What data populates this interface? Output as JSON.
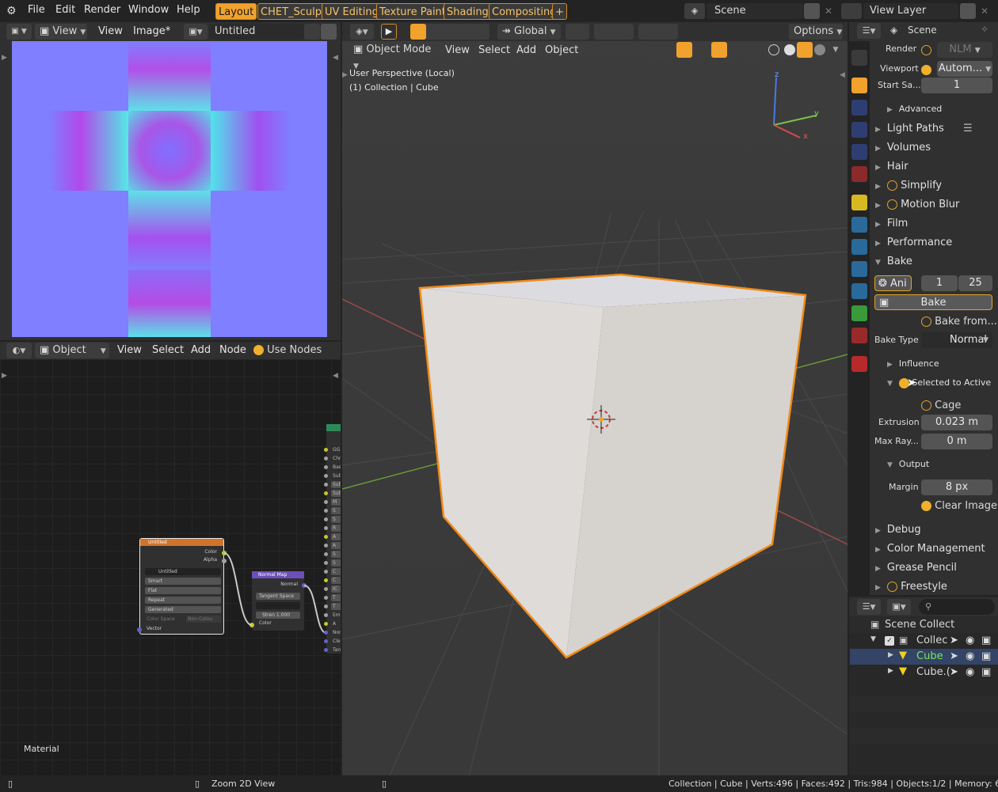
{
  "topbar": {
    "menus": [
      "File",
      "Edit",
      "Render",
      "Window",
      "Help"
    ],
    "workspaces": [
      "Layout",
      "CHET_Sculpt",
      "UV Editing",
      "Texture Paint",
      "Shading",
      "Compositing"
    ],
    "add_tab": "+",
    "scene_name": "Scene",
    "view_layer": "View Layer"
  },
  "image_editor": {
    "view_menu": "View",
    "view2": "View",
    "image_menu": "Image*",
    "image_name": "Untitled"
  },
  "node_editor": {
    "object_select": "Object",
    "menus": [
      "View",
      "Select",
      "Add",
      "Node"
    ],
    "use_nodes": "Use Nodes",
    "footer_label": "Material",
    "image_node": {
      "title": "Untitled",
      "outputs": [
        "Color",
        "Alpha"
      ],
      "image_name": "Untitled",
      "interpolation": "Smart",
      "projection": "Flat",
      "extension": "Repeat",
      "source": "Generated",
      "color_space_label": "Color Space",
      "color_space_value": "Non-Colou",
      "input": "Vector"
    },
    "normal_map_node": {
      "title": "Normal Map",
      "output": "Normal",
      "space": "Tangent Space",
      "strength_label": "Stren",
      "strength_value": "1.000",
      "input": "Color"
    },
    "bsdf_labels": [
      "GG",
      "Chr",
      "Base",
      "Sub",
      "Sub",
      "Subs",
      "M",
      "S",
      "S",
      "R",
      "A",
      "A",
      "S",
      "S",
      "C",
      "C",
      "IC",
      "T",
      "T",
      "Emi",
      "A",
      "Nor",
      "Clea",
      "Tang"
    ]
  },
  "viewport": {
    "transform": "Global",
    "options": "Options",
    "mode": "Object Mode",
    "menus": [
      "View",
      "Select",
      "Add",
      "Object"
    ],
    "info_line1": "User Perspective (Local)",
    "info_line2": "(1) Collection | Cube",
    "axis_x": "x",
    "axis_y": "y",
    "axis_z": "z"
  },
  "properties": {
    "context": "Scene",
    "render_label": "Render",
    "render_value": "NLM",
    "viewport_label": "Viewport",
    "viewport_value": "Autom...",
    "start_samples_label": "Start Sa...",
    "start_samples_value": "1",
    "advanced": "Advanced",
    "sections": [
      "Light Paths",
      "Volumes",
      "Hair",
      "Simplify",
      "Motion Blur",
      "Film",
      "Performance",
      "Bake"
    ],
    "bake": {
      "animation": "Ani",
      "frame_start": "1",
      "frame_end": "25",
      "bake_button": "Bake",
      "bake_from": "Bake from...",
      "bake_type_label": "Bake Type",
      "bake_type_value": "Normal",
      "influence": "Influence",
      "selected_to_active": "Selected to Active",
      "cage": "Cage",
      "extrusion_label": "Extrusion",
      "extrusion_value": "0.023 m",
      "max_ray_label": "Max Ray...",
      "max_ray_value": "0 m",
      "output": "Output",
      "margin_label": "Margin",
      "margin_value": "8 px",
      "clear_image": "Clear Image"
    },
    "sections_after": [
      "Debug",
      "Color Management",
      "Grease Pencil",
      "Freestyle"
    ]
  },
  "outliner": {
    "root": "Scene Collect",
    "collection": "Collec",
    "items": [
      "Cube",
      "Cube.("
    ]
  },
  "statusbar": {
    "hint": "Zoom 2D View",
    "stats": "Collection | Cube | Verts:496 | Faces:492 | Tris:984 | Objects:1/2 | Memory: 61.5 MiB | V"
  },
  "colors": {
    "accent": "#f0a22c",
    "selection_outline": "#f08a1a",
    "background": "#232323",
    "panel": "#303030"
  }
}
